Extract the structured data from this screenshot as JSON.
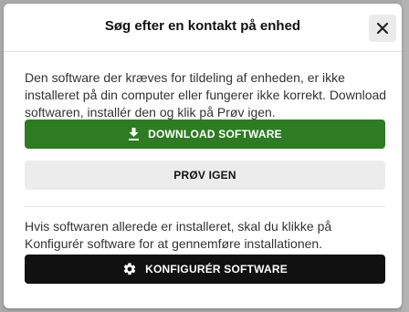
{
  "dialog": {
    "title": "Søg efter en kontakt på enhed",
    "close_icon": "close-icon",
    "message": "Den software der kræves for tildeling af enheden, er ikke installeret på din computer eller fungerer ikke korrekt. Download softwaren, installér den og klik på Prøv igen.",
    "download_label": "DOWNLOAD SOFTWARE",
    "download_icon": "download-icon",
    "retry_label": "PRØV IGEN",
    "configure_message": "Hvis softwaren allerede er installeret, skal du klikke på Konfigurér software for at gennemføre installationen.",
    "configure_label": "KONFIGURÉR SOFTWARE",
    "configure_icon": "gear-icon"
  },
  "colors": {
    "download_button": "#2e7b24",
    "retry_button": "#ececec",
    "configure_button": "#111111"
  }
}
